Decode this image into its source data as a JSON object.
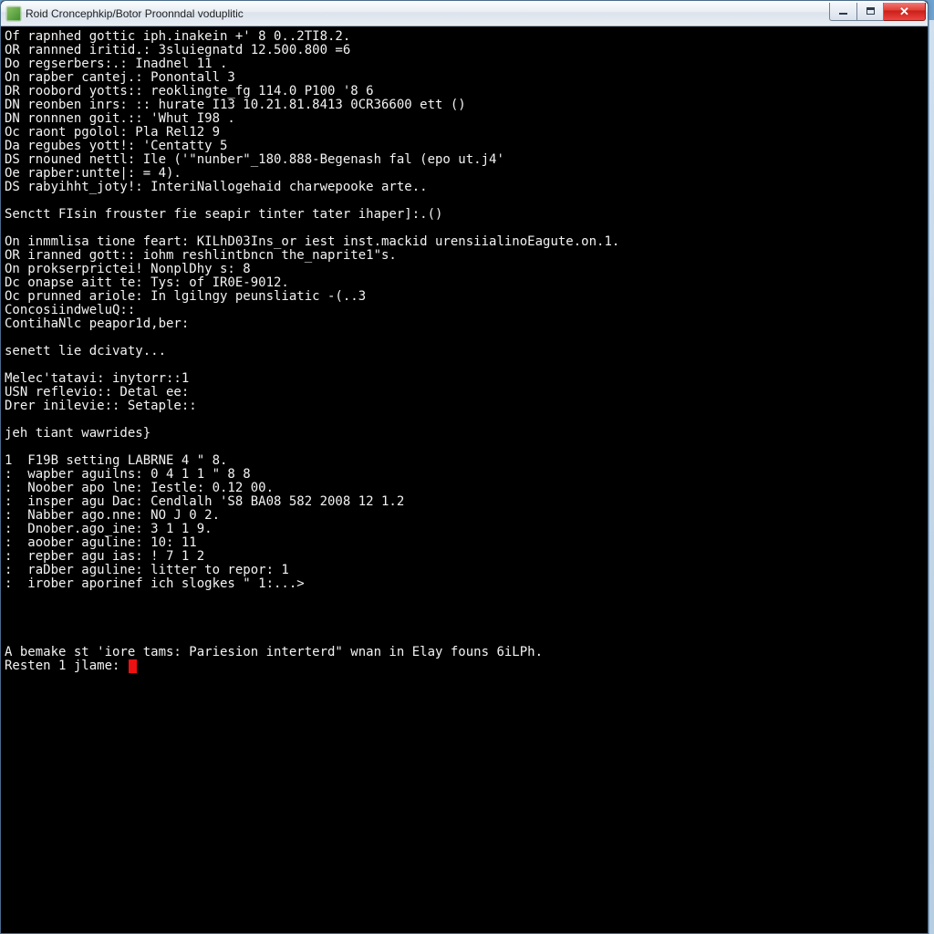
{
  "window": {
    "title": "Roid Croncephkip/Botor Proonndal voduplitic"
  },
  "terminal": {
    "lines": [
      "Of rapnhed gottic iph.inakein +' 8 0..2TI8.2.",
      "OR rannned iritid.: 3sluiegnatd 12.500.800 =6",
      "Do regserbers:.: Inadnel 11 .",
      "On rapber cantej.: Ponontall 3",
      "DR roobord yotts:: reoklingte_fg 114.0 P100 '8 6",
      "DN reonben inrs: :: hurate I13 10.21.81.8413 0CR36600 ett ()",
      "DN ronnnen goit.:: 'Whut I98 .",
      "Oc raont pgolol: Pla Rel12 9",
      "Da regubes yott!: 'Centatty 5",
      "DS rnouned nettl: Ile ('\"nunber\"_180.888-Begenash fal (epo ut.j4'",
      "Oe rapber:untte|: = 4).",
      "DS rabyihht_joty!: InteriNallogehaid charwepooke arte..",
      "",
      "Senctt FIsin frouster fie seapir tinter tater ihaper]:.()",
      "",
      "On inmmlisa tione feart: KILhD03Ins_or iest inst.mackid urensiialinoEagute.on.1.",
      "OR iranned gott:: iohm reshlintbncn the_naprite1\"s.",
      "On prokserprictei! NonplDhy s: 8",
      "Dc onapse aitt te: Tys: of IR0E-9012.",
      "Oc prunned ariole: In lgilngy peunsliatic -(..3",
      "ConcosiindweluQ::",
      "ContihaNlc peapor1d,ber:",
      "",
      "senett lie dcivaty...",
      "",
      "Melec'tatavi: inytorr::1",
      "USN reflevio:: Detal ee:",
      "Drer inilevie:: Setaple::",
      "",
      "jeh tiant wawrides}",
      "",
      "1  F19B setting LABRNE 4 \" 8.",
      ":  wapber aguilns: 0 4 1 1 \" 8 8",
      ":  Noober apo lne: Iestle: 0.12 00.",
      ":  insper agu Dac: Cendlalh 'S8 BA08 582 2008 12 1.2",
      ":  Nabber ago.nne: NO J 0 2.",
      ":  Dnober.ago_ine: 3 1 1 9.",
      ":  aoober aguline: 10: 11",
      ":  repber agu ias: ! 7 1 2",
      ":  raDber aguline: litter to repor: 1",
      ":  irober aporinef ich slogkes \" 1:...>",
      "",
      "",
      "",
      "",
      "A bemake st 'iore tams: Pariesion interterd\" wnan in Elay founs 6iLPh."
    ],
    "prompt": "Resten 1 jlame: "
  }
}
